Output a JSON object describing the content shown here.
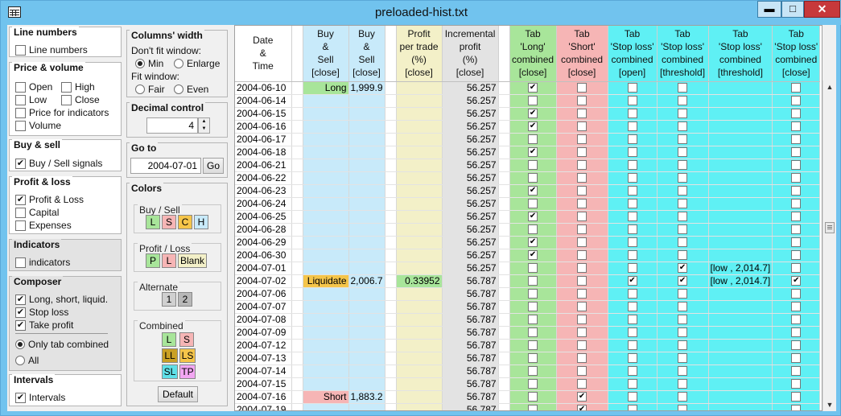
{
  "window": {
    "title": "preloaded-hist.txt",
    "min_label": "▬",
    "max_label": "□",
    "close_label": "✕"
  },
  "left": {
    "line_numbers": {
      "title": "Line numbers",
      "items": [
        {
          "label": "Line numbers",
          "checked": false
        }
      ]
    },
    "price_volume": {
      "title": "Price & volume",
      "items": [
        {
          "label": "Open",
          "checked": false
        },
        {
          "label": "High",
          "checked": false
        },
        {
          "label": "Low",
          "checked": false
        },
        {
          "label": "Close",
          "checked": false
        },
        {
          "label": "Price for indicators",
          "checked": false
        },
        {
          "label": "Volume",
          "checked": false
        }
      ]
    },
    "buy_sell": {
      "title": "Buy & sell",
      "items": [
        {
          "label": "Buy / Sell signals",
          "checked": true
        }
      ]
    },
    "profit_loss": {
      "title": "Profit & loss",
      "items": [
        {
          "label": "Profit & Loss",
          "checked": true
        },
        {
          "label": "Capital",
          "checked": false
        },
        {
          "label": "Expenses",
          "checked": false
        }
      ]
    },
    "indicators": {
      "title": "Indicators",
      "items": [
        {
          "label": "indicators",
          "checked": false
        }
      ]
    },
    "composer": {
      "title": "Composer",
      "items": [
        {
          "label": "Long, short, liquid.",
          "checked": true
        },
        {
          "label": "Stop loss",
          "checked": true
        },
        {
          "label": "Take profit",
          "checked": true
        }
      ],
      "radios": [
        {
          "label": "Only tab combined",
          "selected": true
        },
        {
          "label": "All",
          "selected": false
        }
      ]
    },
    "intervals": {
      "title": "Intervals",
      "items": [
        {
          "label": "Intervals",
          "checked": true
        }
      ]
    }
  },
  "mid": {
    "columns_width": {
      "title": "Columns' width",
      "dont_fit": "Don't fit window:",
      "min": "Min",
      "enlarge": "Enlarge",
      "fit": "Fit window:",
      "fair": "Fair",
      "even": "Even",
      "selected": "Min"
    },
    "decimal": {
      "title": "Decimal control",
      "value": "4"
    },
    "goto": {
      "title": "Go to",
      "value": "2004-07-01",
      "button": "Go"
    },
    "colors": {
      "title": "Colors",
      "buy_sell": {
        "title": "Buy / Sell",
        "chips": [
          {
            "t": "L",
            "c": "#a8e59a"
          },
          {
            "t": "S",
            "c": "#f6b5b5"
          },
          {
            "t": "C",
            "c": "#f5c54a"
          },
          {
            "t": "H",
            "c": "#c8eafa"
          }
        ]
      },
      "profit_loss": {
        "title": "Profit / Loss",
        "chips": [
          {
            "t": "P",
            "c": "#a8e59a"
          },
          {
            "t": "L",
            "c": "#f6b5b5"
          },
          {
            "t": "Blank",
            "c": "#f3f0c8"
          }
        ]
      },
      "alternate": {
        "title": "Alternate",
        "chips": [
          {
            "t": "1",
            "c": "#d0d0d0"
          },
          {
            "t": "2",
            "c": "#b8b8b8"
          }
        ]
      },
      "combined": {
        "title": "Combined",
        "chips": [
          {
            "t": "L",
            "c": "#a8e59a"
          },
          {
            "t": "S",
            "c": "#f6b5b5"
          },
          {
            "t": "LL",
            "c": "#c9a025"
          },
          {
            "t": "LS",
            "c": "#f5c54a"
          },
          {
            "t": "SL",
            "c": "#5fe0e8"
          },
          {
            "t": "TP",
            "c": "#f2a6f2"
          }
        ]
      },
      "default_button": "Default"
    }
  },
  "grid": {
    "headers": [
      "Date\n&\nTime",
      "",
      "Buy\n&\nSell\n[close]",
      "Buy\n&\nSell\n[close]",
      "",
      "Profit\nper trade\n(%)\n[close]",
      "Incremental\nprofit\n(%)\n[close]",
      "",
      "Tab\n'Long'\ncombined\n[close]",
      "Tab\n'Short'\ncombined\n[close]",
      "Tab\n'Stop loss'\ncombined\n[open]",
      "Tab\n'Stop loss'\ncombined\n[threshold]",
      "Tab\n'Stop loss'\ncombined\n[threshold]",
      "Tab\n'Stop loss'\ncombined\n[close]"
    ],
    "rows": [
      [
        "2004-06-10",
        "Long",
        "1,999.9",
        "",
        "56.257",
        true,
        false,
        false,
        false,
        "",
        false
      ],
      [
        "2004-06-14",
        "",
        "",
        "",
        "56.257",
        false,
        false,
        false,
        false,
        "",
        false
      ],
      [
        "2004-06-15",
        "",
        "",
        "",
        "56.257",
        true,
        false,
        false,
        false,
        "",
        false
      ],
      [
        "2004-06-16",
        "",
        "",
        "",
        "56.257",
        true,
        false,
        false,
        false,
        "",
        false
      ],
      [
        "2004-06-17",
        "",
        "",
        "",
        "56.257",
        false,
        false,
        false,
        false,
        "",
        false
      ],
      [
        "2004-06-18",
        "",
        "",
        "",
        "56.257",
        true,
        false,
        false,
        false,
        "",
        false
      ],
      [
        "2004-06-21",
        "",
        "",
        "",
        "56.257",
        false,
        false,
        false,
        false,
        "",
        false
      ],
      [
        "2004-06-22",
        "",
        "",
        "",
        "56.257",
        false,
        false,
        false,
        false,
        "",
        false
      ],
      [
        "2004-06-23",
        "",
        "",
        "",
        "56.257",
        true,
        false,
        false,
        false,
        "",
        false
      ],
      [
        "2004-06-24",
        "",
        "",
        "",
        "56.257",
        false,
        false,
        false,
        false,
        "",
        false
      ],
      [
        "2004-06-25",
        "",
        "",
        "",
        "56.257",
        true,
        false,
        false,
        false,
        "",
        false
      ],
      [
        "2004-06-28",
        "",
        "",
        "",
        "56.257",
        false,
        false,
        false,
        false,
        "",
        false
      ],
      [
        "2004-06-29",
        "",
        "",
        "",
        "56.257",
        true,
        false,
        false,
        false,
        "",
        false
      ],
      [
        "2004-06-30",
        "",
        "",
        "",
        "56.257",
        true,
        false,
        false,
        false,
        "",
        false
      ],
      [
        "2004-07-01",
        "",
        "",
        "",
        "56.257",
        false,
        false,
        false,
        true,
        "[low , 2,014.7]",
        false
      ],
      [
        "2004-07-02",
        "Liquidate",
        "2,006.7",
        "0.33952",
        "56.787",
        false,
        false,
        true,
        true,
        "[low , 2,014.7]",
        true
      ],
      [
        "2004-07-06",
        "",
        "",
        "",
        "56.787",
        false,
        false,
        false,
        false,
        "",
        false
      ],
      [
        "2004-07-07",
        "",
        "",
        "",
        "56.787",
        false,
        false,
        false,
        false,
        "",
        false
      ],
      [
        "2004-07-08",
        "",
        "",
        "",
        "56.787",
        false,
        false,
        false,
        false,
        "",
        false
      ],
      [
        "2004-07-09",
        "",
        "",
        "",
        "56.787",
        false,
        false,
        false,
        false,
        "",
        false
      ],
      [
        "2004-07-12",
        "",
        "",
        "",
        "56.787",
        false,
        false,
        false,
        false,
        "",
        false
      ],
      [
        "2004-07-13",
        "",
        "",
        "",
        "56.787",
        false,
        false,
        false,
        false,
        "",
        false
      ],
      [
        "2004-07-14",
        "",
        "",
        "",
        "56.787",
        false,
        false,
        false,
        false,
        "",
        false
      ],
      [
        "2004-07-15",
        "",
        "",
        "",
        "56.787",
        false,
        false,
        false,
        false,
        "",
        false
      ],
      [
        "2004-07-16",
        "Short",
        "1,883.2",
        "",
        "56.787",
        false,
        true,
        false,
        false,
        "",
        false
      ],
      [
        "2004-07-19",
        "",
        "",
        "",
        "56.787",
        false,
        true,
        false,
        false,
        "",
        false
      ]
    ],
    "signal_colors": {
      "Long": "#a8e59a",
      "Short": "#f6b5b5",
      "Liquidate": "#f5c54a"
    },
    "col_colors": [
      "#ffffff",
      "#ffffff",
      "#c8eafa",
      "#c8eafa",
      "#ffffff",
      "#f3f0c8",
      "#e3e3e3",
      "#ffffff",
      "#a8e59a",
      "#f6b5b5",
      "#5ff0f4",
      "#5ff0f4",
      "#5ff0f4",
      "#5ff0f4"
    ],
    "profit_color": "#a8e59a"
  },
  "icons": {
    "scroll_up": "▲",
    "scroll_down": "▼",
    "check": "✔"
  }
}
